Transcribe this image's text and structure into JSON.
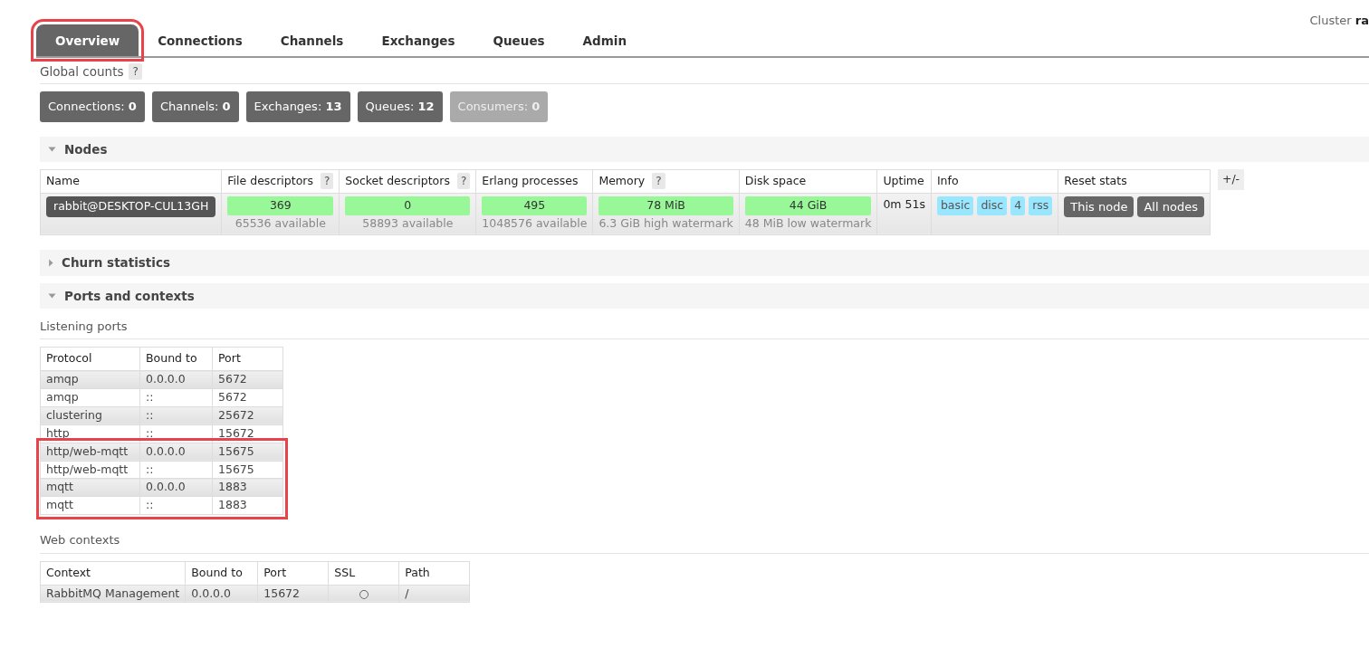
{
  "cluster": {
    "label": "Cluster",
    "name": "ra"
  },
  "tabs": [
    {
      "label": "Overview",
      "selected": true,
      "highlighted": true
    },
    {
      "label": "Connections",
      "selected": false,
      "highlighted": false
    },
    {
      "label": "Channels",
      "selected": false,
      "highlighted": false
    },
    {
      "label": "Exchanges",
      "selected": false,
      "highlighted": false
    },
    {
      "label": "Queues",
      "selected": false,
      "highlighted": false
    },
    {
      "label": "Admin",
      "selected": false,
      "highlighted": false
    }
  ],
  "global_counts": {
    "title": "Global counts",
    "help": "?",
    "counts": [
      {
        "label": "Connections:",
        "value": "0",
        "disabled": false
      },
      {
        "label": "Channels:",
        "value": "0",
        "disabled": false
      },
      {
        "label": "Exchanges:",
        "value": "13",
        "disabled": false
      },
      {
        "label": "Queues:",
        "value": "12",
        "disabled": false
      },
      {
        "label": "Consumers:",
        "value": "0",
        "disabled": true
      }
    ]
  },
  "nodes": {
    "title": "Nodes",
    "expanded": true,
    "toggle": "+/-",
    "columns": [
      {
        "label": "Name"
      },
      {
        "label": "File descriptors",
        "help": "?"
      },
      {
        "label": "Socket descriptors",
        "help": "?"
      },
      {
        "label": "Erlang processes"
      },
      {
        "label": "Memory",
        "help": "?"
      },
      {
        "label": "Disk space"
      },
      {
        "label": "Uptime"
      },
      {
        "label": "Info"
      },
      {
        "label": "Reset stats"
      }
    ],
    "rows": [
      {
        "name": "rabbit@DESKTOP-CUL13GH",
        "file_descriptors": {
          "value": "369",
          "detail": "65536 available"
        },
        "socket_descriptors": {
          "value": "0",
          "detail": "58893 available"
        },
        "erlang_processes": {
          "value": "495",
          "detail": "1048576 available"
        },
        "memory": {
          "value": "78 MiB",
          "detail": "6.3 GiB high watermark"
        },
        "disk_space": {
          "value": "44 GiB",
          "detail": "48 MiB low watermark"
        },
        "uptime": "0m 51s",
        "info": [
          "basic",
          "disc",
          "4",
          "rss"
        ],
        "reset_buttons": [
          "This node",
          "All nodes"
        ]
      }
    ]
  },
  "churn": {
    "title": "Churn statistics",
    "expanded": false
  },
  "ports_section": {
    "title": "Ports and contexts",
    "expanded": true,
    "listening_ports": {
      "title": "Listening ports",
      "columns": [
        "Protocol",
        "Bound to",
        "Port"
      ],
      "rows": [
        {
          "protocol": "amqp",
          "bound_to": "0.0.0.0",
          "port": "5672",
          "highlighted": false
        },
        {
          "protocol": "amqp",
          "bound_to": "::",
          "port": "5672",
          "highlighted": false
        },
        {
          "protocol": "clustering",
          "bound_to": "::",
          "port": "25672",
          "highlighted": false
        },
        {
          "protocol": "http",
          "bound_to": "::",
          "port": "15672",
          "highlighted": false
        },
        {
          "protocol": "http/web-mqtt",
          "bound_to": "0.0.0.0",
          "port": "15675",
          "highlighted": true
        },
        {
          "protocol": "http/web-mqtt",
          "bound_to": "::",
          "port": "15675",
          "highlighted": true
        },
        {
          "protocol": "mqtt",
          "bound_to": "0.0.0.0",
          "port": "1883",
          "highlighted": true
        },
        {
          "protocol": "mqtt",
          "bound_to": "::",
          "port": "1883",
          "highlighted": true
        }
      ]
    },
    "web_contexts": {
      "title": "Web contexts",
      "columns": [
        "Context",
        "Bound to",
        "Port",
        "SSL",
        "Path"
      ],
      "rows": [
        {
          "context": "RabbitMQ Management",
          "bound_to": "0.0.0.0",
          "port": "15672",
          "ssl": "○",
          "path": "/"
        }
      ]
    }
  }
}
